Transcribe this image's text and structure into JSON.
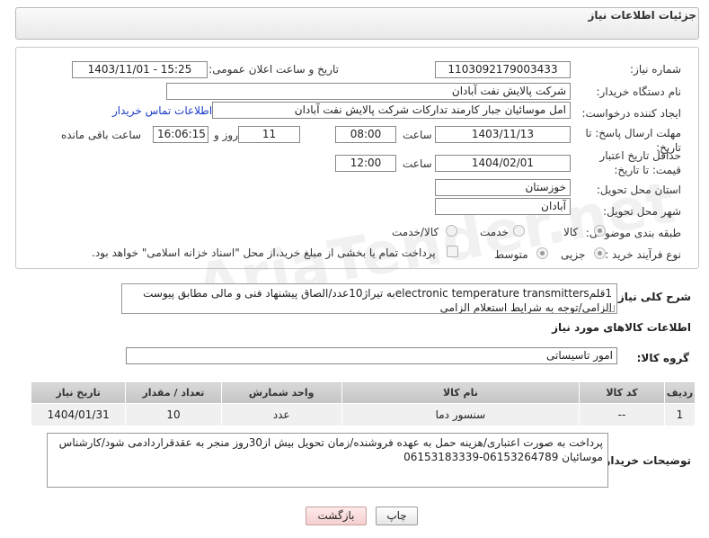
{
  "panel": {
    "title": "جزئیات اطلاعات نیاز"
  },
  "labels": {
    "need_number": "شماره نیاز:",
    "announce_datetime": "تاریخ و ساعت اعلان عمومی:",
    "buyer_org": "نام دستگاه خریدار:",
    "requester": "ایجاد کننده درخواست:",
    "contact_link": "اطلاعات تماس خریدار",
    "reply_deadline": "مهلت ارسال پاسخ: تا تاریخ:",
    "time": "ساعت",
    "day_and": "روز و",
    "remaining": "ساعت باقی مانده",
    "price_validity": "حداقل تاریخ اعتبار قیمت: تا تاریخ:",
    "province": "استان محل تحویل:",
    "city": "شهر محل تحویل:",
    "category": "طبقه بندی موضوعی:",
    "purchase_type": "نوع فرآیند خرید :",
    "summary": "شرح کلی نیاز:",
    "goods_info": "اطلاعات کالاهای مورد نیاز",
    "goods_group": "گروه کالا:",
    "buyer_notes": "توضیحات خریدار:"
  },
  "fields": {
    "need_number": "1103092179003433",
    "announce_datetime": "1403/11/01 - 15:25",
    "buyer_org": "شرکت پالایش نفت آبادان",
    "requester": "امل موسائیان جبار کارمند تدارکات شرکت پالایش نفت آبادان",
    "reply_date": "1403/11/13",
    "reply_time": "08:00",
    "days": "11",
    "remaining_time": "16:06:15",
    "validity_date": "1404/02/01",
    "validity_time": "12:00",
    "province": "خوزستان",
    "city": "آبادان",
    "summary": "1قلمelectronic temperature transmittersبه تیراژ10عدد/الصاق پیشنهاد فنی و مالی مطابق پیوست الزامی/توجه به شرایط استعلام الزامی",
    "goods_group": "امور تاسیساتی",
    "buyer_notes": "پرداخت به صورت اعتباری/هزینه حمل به عهده فروشنده/زمان تحویل بیش از30روز منجر به عقدقراردادمی شود/کارشناس موسائیان 06153264789-06153183339"
  },
  "category_options": [
    {
      "label": "کالا",
      "selected": true
    },
    {
      "label": "خدمت",
      "selected": false
    },
    {
      "label": "کالا/خدمت",
      "selected": false
    }
  ],
  "purchase_options": [
    {
      "label": "جزیی",
      "selected": true
    },
    {
      "label": "متوسط",
      "selected": false
    }
  ],
  "payment_note": "پرداخت تمام یا بخشی از مبلغ خرید،از محل \"اسناد خزانه اسلامی\" خواهد بود.",
  "table": {
    "headers": [
      "ردیف",
      "کد کالا",
      "نام کالا",
      "واحد شمارش",
      "تعداد / مقدار",
      "تاریخ نیاز"
    ],
    "rows": [
      [
        "1",
        "--",
        "سنسور دما",
        "عدد",
        "10",
        "1404/01/31"
      ]
    ]
  },
  "buttons": {
    "print": "چاپ",
    "back": "بازگشت"
  },
  "watermark": "AriaTender.net"
}
